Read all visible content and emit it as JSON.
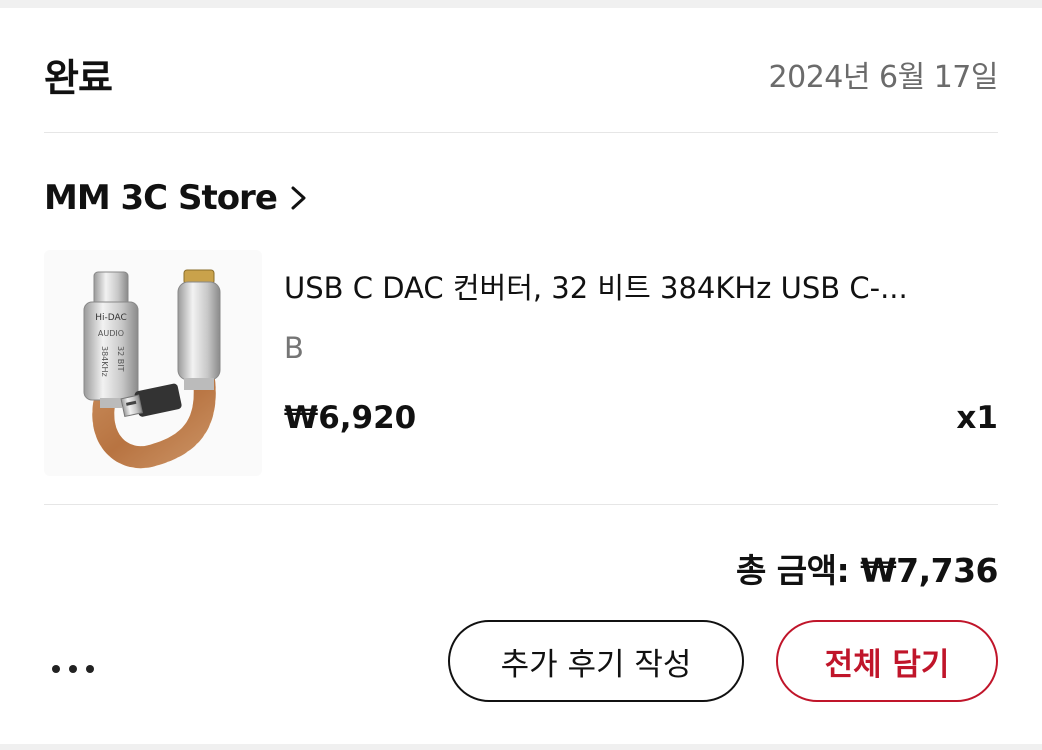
{
  "order": {
    "status": "완료",
    "date": "2024년 6월 17일"
  },
  "store": {
    "name": "MM 3C Store",
    "chevron_icon": "chevron-right-icon"
  },
  "product": {
    "image_icon": "usb-c-dac-adapter-image",
    "image_text": {
      "brand": "Hi-DAC",
      "label1": "AUDIO",
      "label2": "384KHz",
      "label3": "32 BIT"
    },
    "title": "USB C DAC 컨버터, 32 비트 384KHz USB C-...",
    "option": "B",
    "price": "₩6,920",
    "quantity": "x1"
  },
  "summary": {
    "total": "총 금액: ₩7,736"
  },
  "actions": {
    "more_icon": "more-horizontal-icon",
    "review_label": "추가 후기 작성",
    "cart_label": "전체 담기"
  },
  "colors": {
    "accent": "#c0152a",
    "muted_text": "#6b6b6b",
    "divider": "#e6e6e6"
  }
}
